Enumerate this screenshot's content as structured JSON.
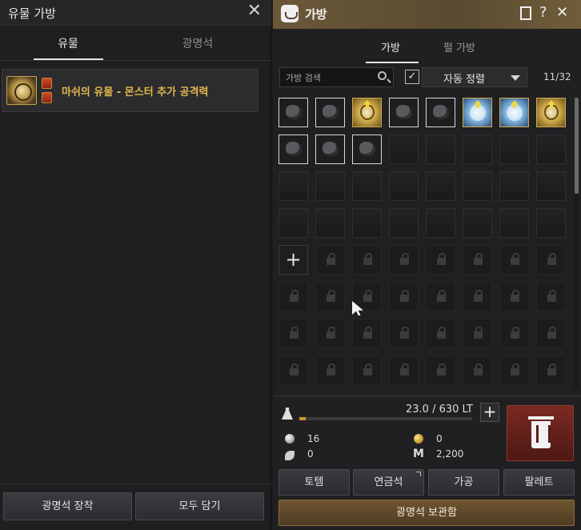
{
  "left_panel": {
    "title": "유물 가방",
    "close_icon": "✕",
    "tabs": [
      {
        "label": "유물",
        "active": true
      },
      {
        "label": "광명석",
        "active": false
      }
    ],
    "relic_item": {
      "name": "마쉬의 유물 - 몬스터 추가 공격력"
    },
    "buttons": {
      "equip": "광명석 장착",
      "collect_all": "모두 담기"
    }
  },
  "right_panel": {
    "title": "가방",
    "header_icons": [
      "document-icon",
      "help-icon",
      "close-icon"
    ],
    "help_label": "?",
    "close_label": "✕",
    "tabs": [
      {
        "label": "가방",
        "active": true
      },
      {
        "label": "펄 가방",
        "active": false
      }
    ],
    "search": {
      "placeholder": "가방 검색"
    },
    "auto_sort": {
      "checked": true,
      "check_mark": "✓",
      "label": "자동 정렬"
    },
    "slot_count": "11/32",
    "weight": {
      "current": 23.0,
      "max": 630,
      "text": "23.0 / 630 LT"
    },
    "currencies": [
      {
        "icon": "silver-coin-icon",
        "value": "16"
      },
      {
        "icon": "gold-coin-icon",
        "value": "0"
      },
      {
        "icon": "leaf-icon",
        "value": "0"
      },
      {
        "icon": "energy-icon",
        "value": "2,200"
      }
    ],
    "energy_mark": "M",
    "add_label": "+",
    "buttons": {
      "totem": "토템",
      "alchemy_stone": "연금석",
      "processing": "가공",
      "palette": "팔레트",
      "crystal_storage": "광명석 보관함"
    }
  },
  "colors": {
    "accent_gold": "#e3b84a",
    "title_bar": "#6b5839",
    "trash_red": "#7a2a22",
    "storage_button": "#6f5632"
  }
}
